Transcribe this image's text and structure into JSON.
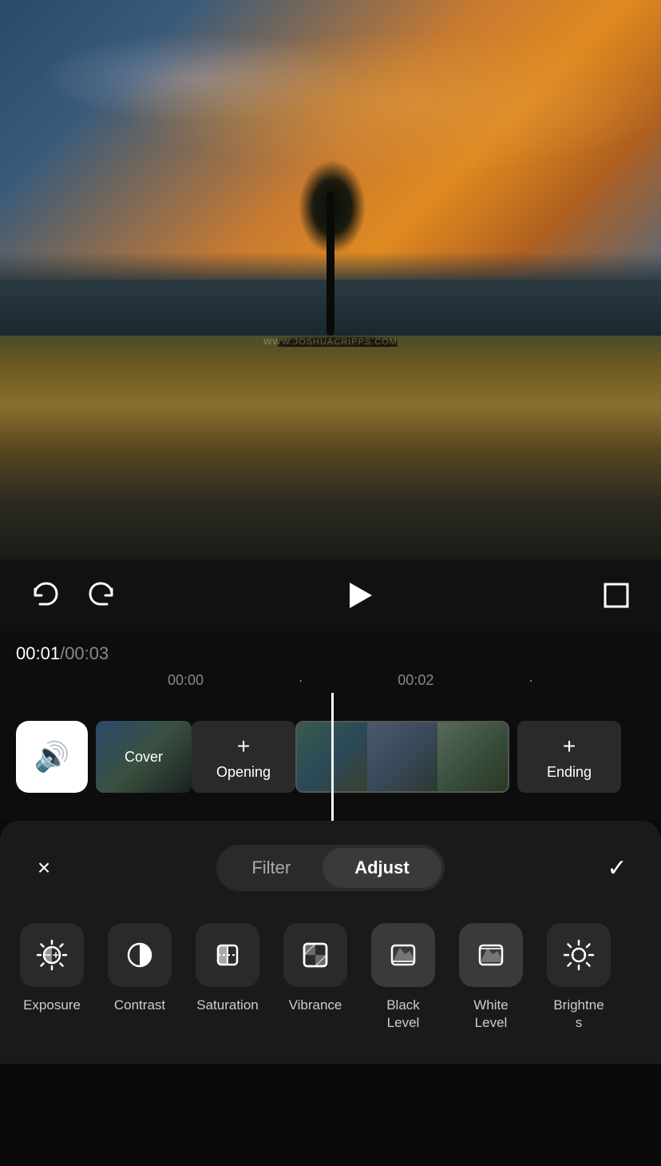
{
  "video": {
    "watermark": "WWW.JOSHUACRIPPS.COM"
  },
  "controls": {
    "undo_label": "undo",
    "redo_label": "redo",
    "play_label": "play",
    "fullscreen_label": "fullscreen"
  },
  "timeline": {
    "current_time": "00:01",
    "total_time": "00:03",
    "marker1": "00:00",
    "marker2": "00:02",
    "cover_label": "Cover",
    "opening_label": "Opening",
    "ending_label": "Ending"
  },
  "panel": {
    "close_label": "×",
    "check_label": "✓",
    "tabs": [
      {
        "id": "filter",
        "label": "Filter",
        "active": false
      },
      {
        "id": "adjust",
        "label": "Adjust",
        "active": true
      }
    ],
    "tools": [
      {
        "id": "exposure",
        "label": "Exposure",
        "icon": "exposure"
      },
      {
        "id": "contrast",
        "label": "Contrast",
        "icon": "contrast"
      },
      {
        "id": "saturation",
        "label": "Saturation",
        "icon": "saturation"
      },
      {
        "id": "vibrance",
        "label": "Vibrance",
        "icon": "vibrance"
      },
      {
        "id": "black-level",
        "label": "Black\nLevel",
        "icon": "black-level",
        "active": true
      },
      {
        "id": "white-level",
        "label": "White\nLevel",
        "icon": "white-level",
        "active": true
      },
      {
        "id": "brightness",
        "label": "Brightne\ns",
        "icon": "brightness"
      }
    ]
  }
}
